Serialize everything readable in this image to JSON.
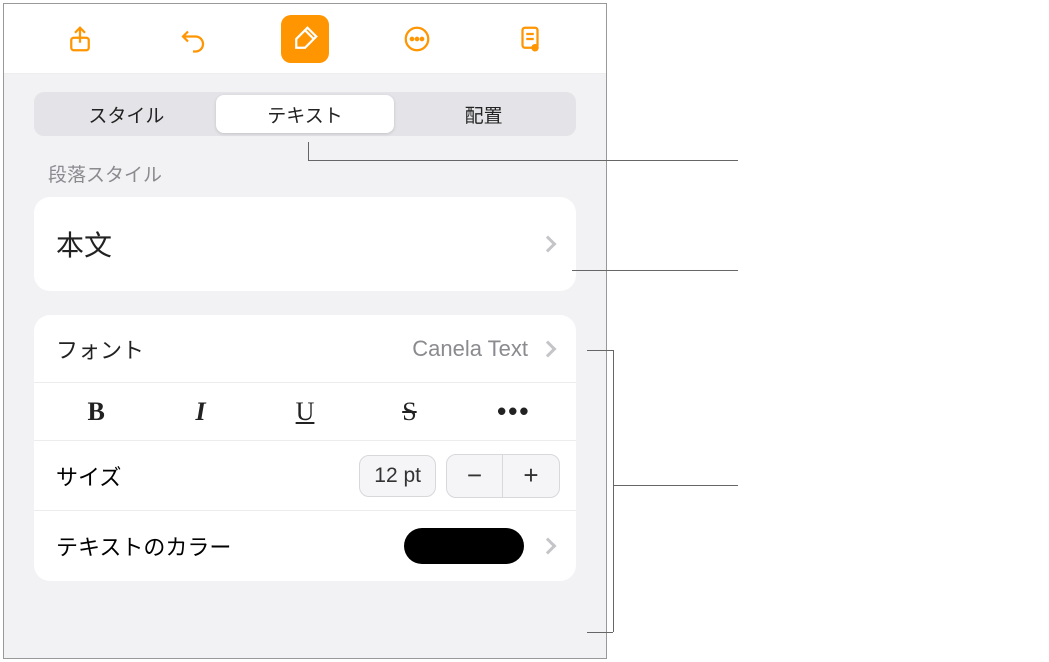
{
  "toolbar": {
    "icons": [
      "share-icon",
      "undo-icon",
      "brush-icon",
      "more-icon",
      "doc-icon"
    ]
  },
  "tabs": {
    "items": [
      "スタイル",
      "テキスト",
      "配置"
    ],
    "activeIndex": 1
  },
  "paragraphStyle": {
    "label": "段落スタイル",
    "value": "本文"
  },
  "font": {
    "label": "フォント",
    "value": "Canela Text",
    "styles": {
      "bold": "B",
      "italic": "I",
      "underline": "U",
      "strike": "S",
      "more": "•••"
    }
  },
  "size": {
    "label": "サイズ",
    "value": "12 pt",
    "minus": "−",
    "plus": "+"
  },
  "textColor": {
    "label": "テキストのカラー",
    "value": "#000000"
  }
}
